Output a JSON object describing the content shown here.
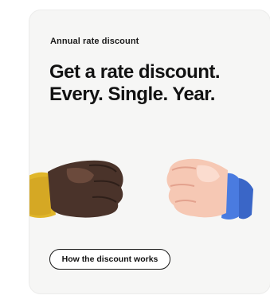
{
  "card": {
    "eyebrow": "Annual rate discount",
    "headline_line1": "Get a rate discount.",
    "headline_line2": "Every. Single. Year.",
    "cta_label": "How the discount works"
  },
  "illustration": {
    "left_icon": "dark-fist-icon",
    "right_icon": "light-fist-icon"
  },
  "colors": {
    "card_background": "#f6f6f5",
    "left_sleeve": "#e0b62a",
    "right_sleeve": "#4a7be0",
    "dark_skin": "#4a332a",
    "light_skin": "#f6c8b4"
  }
}
